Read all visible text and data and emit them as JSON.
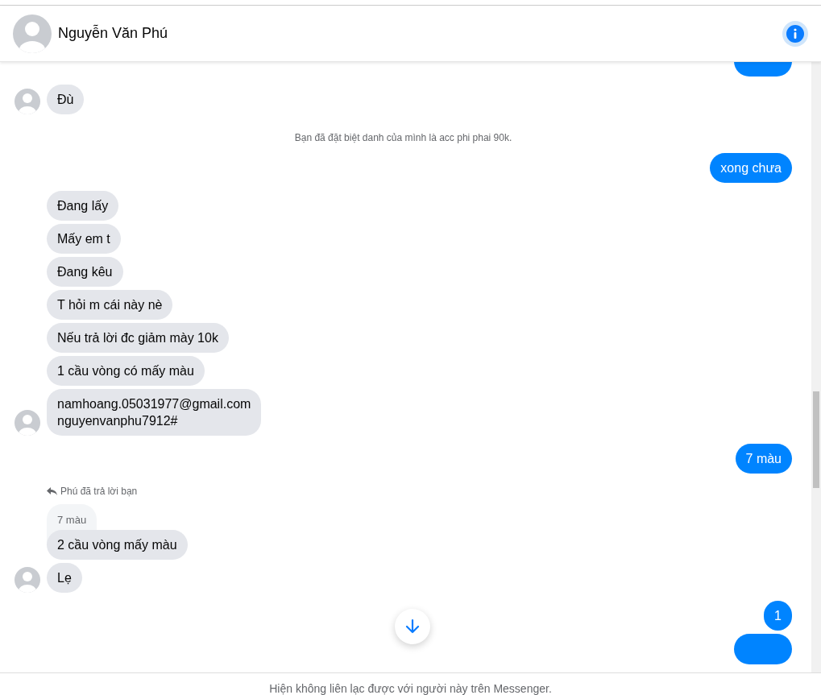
{
  "header": {
    "name": "Nguyễn Văn Phú"
  },
  "messages": [
    {
      "kind": "cut_out"
    },
    {
      "kind": "in_group",
      "texts": [
        "Đù"
      ]
    },
    {
      "kind": "note",
      "text": "Bạn đã đặt biệt danh của mình là acc phi phai 90k."
    },
    {
      "kind": "out",
      "text": "xong chưa"
    },
    {
      "kind": "in_group",
      "texts": [
        "Đang lấy",
        "Mấy em t",
        "Đang kêu",
        "T hỏi m cái này nè",
        "Nếu trả lời đc giảm mày 10k",
        "1 cầu vòng có mấy màu",
        "namhoang.05031977@gmail.com\nnguyenvanphu7912#"
      ]
    },
    {
      "kind": "out",
      "text": "7 màu"
    },
    {
      "kind": "reply",
      "label": "Phú đã trả lời bạn",
      "quote": "7 màu",
      "texts": [
        "2 cầu vòng mấy màu",
        "Lẹ"
      ]
    },
    {
      "kind": "out",
      "text": "1"
    },
    {
      "kind": "cut_out"
    }
  ],
  "footer": {
    "text": "Hiện không liên lạc được với người này trên Messenger."
  }
}
